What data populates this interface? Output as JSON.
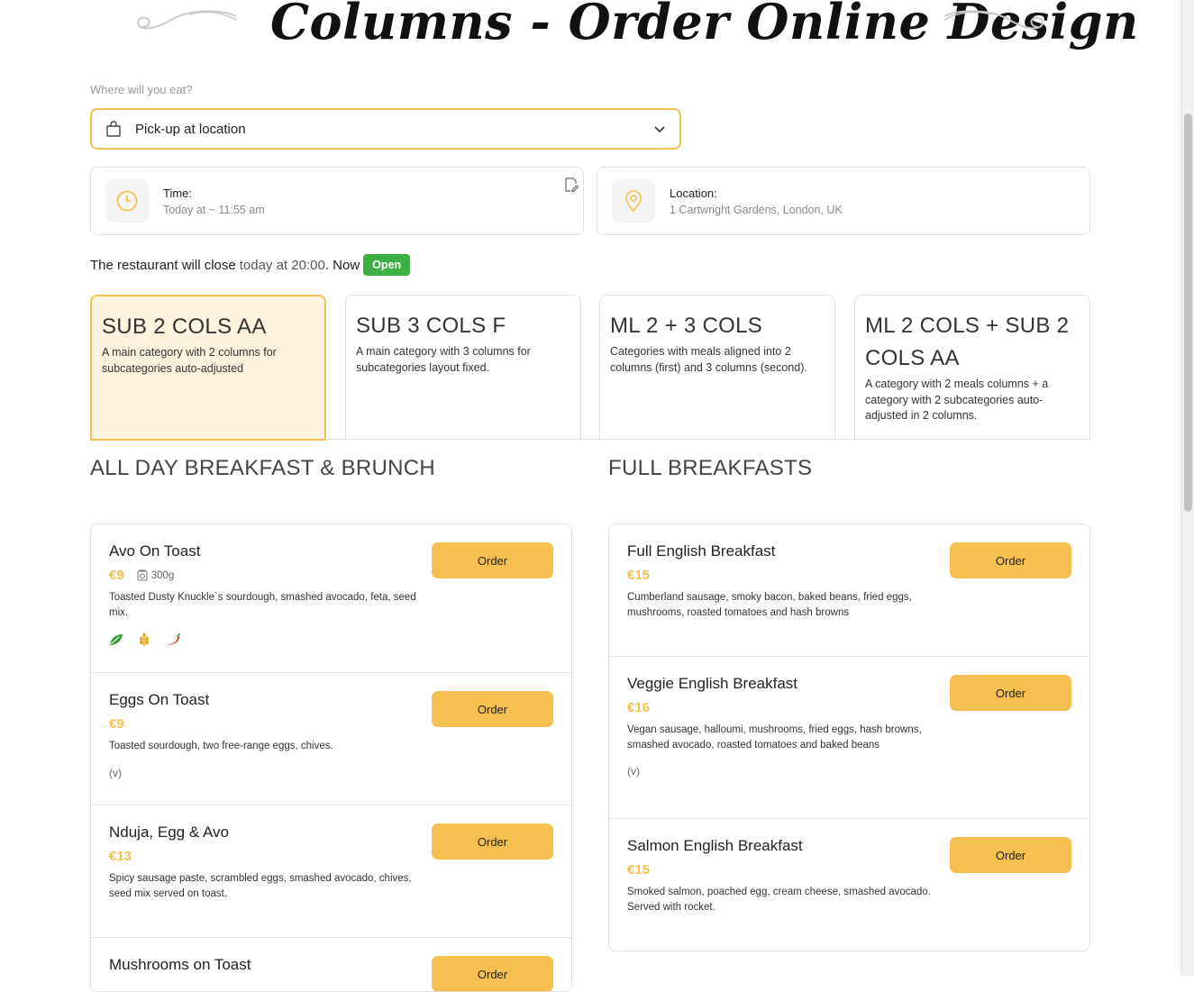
{
  "header": {
    "title": "Columns - Order Online Design"
  },
  "order_type": {
    "label": "Where will you eat?",
    "selected": "Pick-up at location"
  },
  "time_card": {
    "label": "Time:",
    "value": "Today at ~ 11:55 am"
  },
  "location_card": {
    "label": "Location:",
    "value": "1 Cartwright Gardens, London, UK"
  },
  "status": {
    "prefix": "The restaurant will close",
    "close_time": "today at 20:00",
    "suffix": ". Now",
    "badge": "Open",
    "badge_color": "#3cb043"
  },
  "categories": [
    {
      "title": "SUB 2 COLS AA",
      "desc": "A main category with 2 columns for subcategories auto-adjusted",
      "active": true
    },
    {
      "title": "SUB 3 COLS F",
      "desc": "A main category with 3 columns for subcategories layout fixed.",
      "active": false
    },
    {
      "title": "ML 2 + 3 COLS",
      "desc": "Categories with meals aligned into 2 columns (first) and 3 columns (second).",
      "active": false
    },
    {
      "title": "ML 2 COLS + SUB 2 COLS AA",
      "desc": "A category with 2 meals columns + a category with 2 subcategories auto-adjusted in 2 columns.",
      "active": false
    }
  ],
  "sections": {
    "left": {
      "title": "ALL DAY BREAKFAST & BRUNCH",
      "items": [
        {
          "name": "Avo On Toast",
          "price": "€9",
          "weight": "300g",
          "desc": "Toasted Dusty Knuckle`s sourdough, smashed avocado, feta, seed mix.",
          "tags": [
            "leaf-icon",
            "wheat-icon",
            "chili-icon"
          ],
          "order": "Order"
        },
        {
          "name": "Eggs On Toast",
          "price": "€9",
          "desc": "Toasted sourdough, two free-range eggs, chives.",
          "veg": "(v)",
          "order": "Order"
        },
        {
          "name": "Nduja, Egg & Avo",
          "price": "€13",
          "desc": "Spicy sausage paste, scrambled eggs, smashed avocado, chives, seed mix served on toast.",
          "order": "Order"
        },
        {
          "name": "Mushrooms on Toast",
          "order": "Order"
        }
      ]
    },
    "right": {
      "title": "FULL BREAKFASTS",
      "items": [
        {
          "name": "Full English Breakfast",
          "price": "€15",
          "desc": "Cumberland sausage, smoky bacon, baked beans, fried eggs, mushrooms, roasted tomatoes and hash browns",
          "order": "Order"
        },
        {
          "name": "Veggie English Breakfast",
          "price": "€16",
          "desc": "Vegan sausage, halloumi, mushrooms, fried eggs, hash browns, smashed avocado, roasted tomatoes and baked beans",
          "veg": "(v)",
          "order": "Order"
        },
        {
          "name": "Salmon English Breakfast",
          "price": "€15",
          "desc": "Smoked salmon, poached egg, cream cheese, smashed avocado. Served with rocket.",
          "order": "Order"
        }
      ]
    }
  },
  "colors": {
    "accent": "#f5c04f",
    "active_bg": "#fdf2dd",
    "open_green": "#3cb043"
  }
}
